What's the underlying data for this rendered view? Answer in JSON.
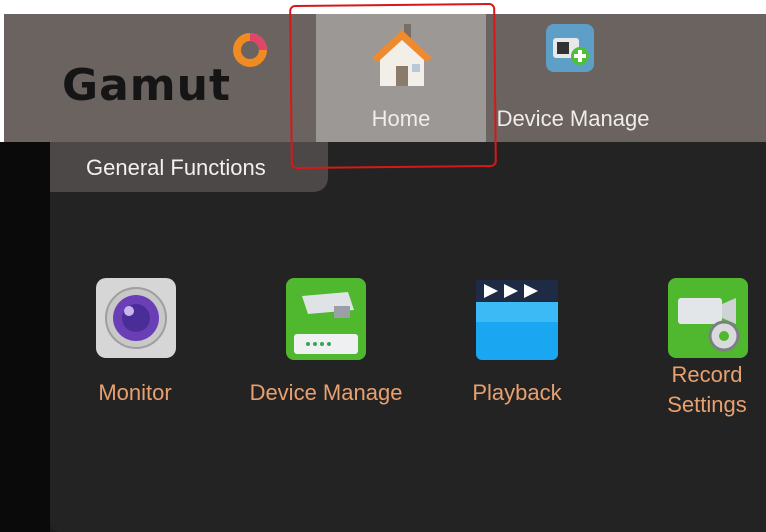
{
  "app": {
    "logo_text": "Gamut",
    "logo_icon": "orange-ring-logo-icon"
  },
  "topnav": {
    "tabs": [
      {
        "label": "Home",
        "icon": "house-icon",
        "active": true
      },
      {
        "label": "Device Manage",
        "icon": "device-add-icon",
        "active": false
      }
    ]
  },
  "section": {
    "title": "General Functions"
  },
  "functions": [
    {
      "label": "Monitor",
      "icon": "camera-lens-icon"
    },
    {
      "label": "Device Manage",
      "icon": "device-manage-icon"
    },
    {
      "label": "Playback",
      "icon": "clapperboard-icon"
    },
    {
      "label": "Record Settings",
      "icon": "camera-gear-icon"
    }
  ],
  "colors": {
    "topbar": "#6b6360",
    "active_tab": "#9c9896",
    "function_label": "#e8a06e",
    "annotation": "#d81818"
  }
}
